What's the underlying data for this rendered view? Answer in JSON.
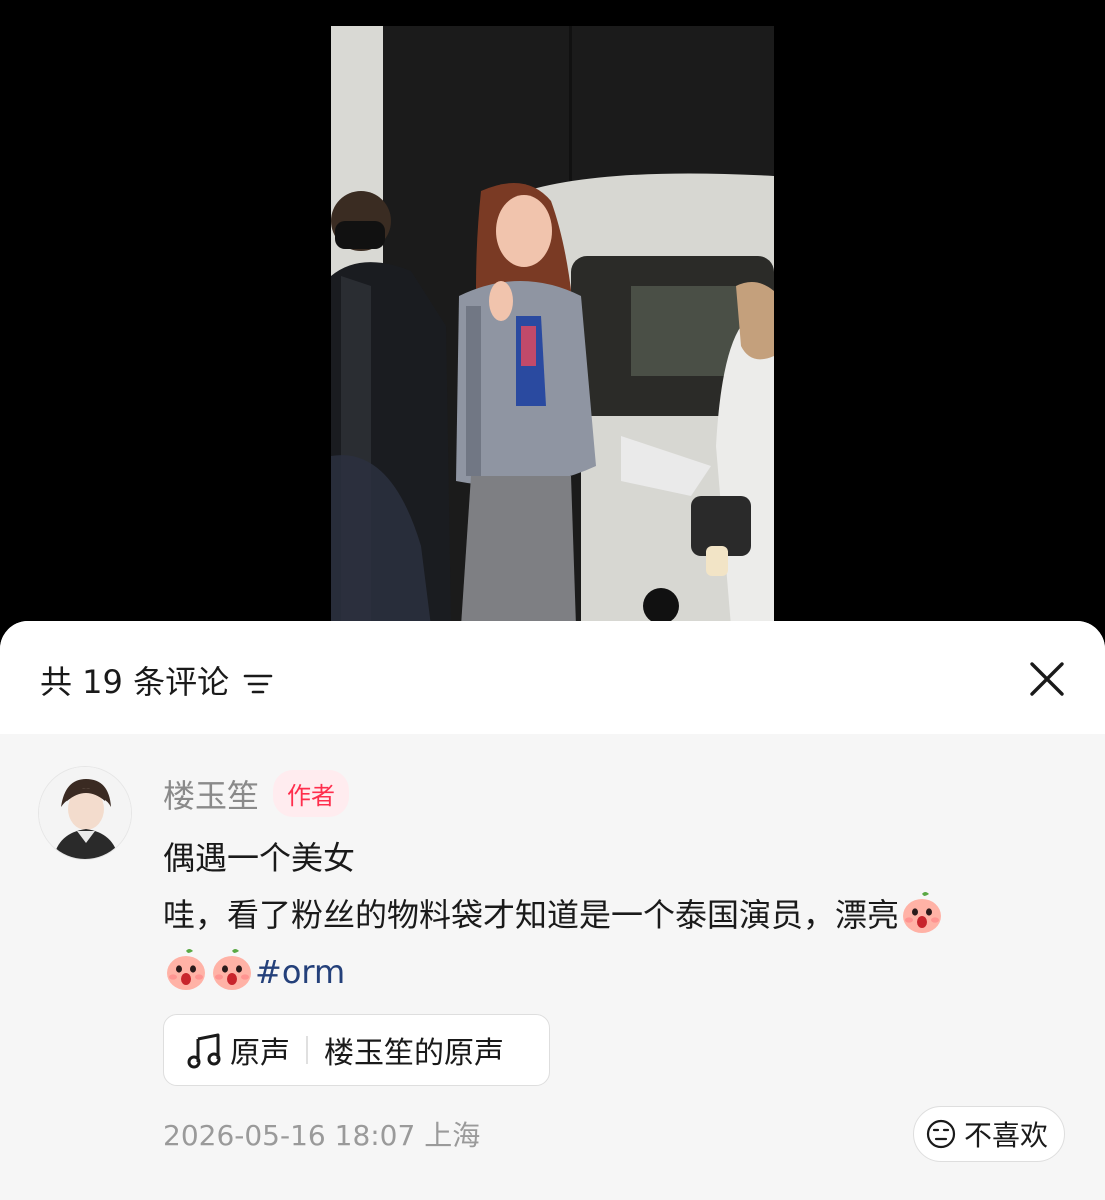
{
  "header": {
    "title": "共 19 条评论"
  },
  "comment": {
    "username": "楼玉笙",
    "author_badge": "作者",
    "line1": "偶遇一个美女",
    "line2": "哇，看了粉丝的物料袋才知道是一个泰国演员，漂亮",
    "hashtag": "#orm",
    "sound_label": "原声",
    "sound_source": "楼玉笙的原声",
    "timestamp": "2026-05-16 18:07",
    "location": "上海",
    "dislike_label": "不喜欢"
  },
  "colors": {
    "author_badge_text": "#ff2e4d",
    "author_badge_bg": "#ffecef",
    "hashtag": "#24407a",
    "sheet_bg": "#f6f6f6"
  },
  "icons": {
    "filter": "filter-icon",
    "close": "close-icon",
    "music_note": "music-note-icon",
    "emoji": "scream-peach-emoji",
    "dislike": "dislike-face-icon"
  }
}
